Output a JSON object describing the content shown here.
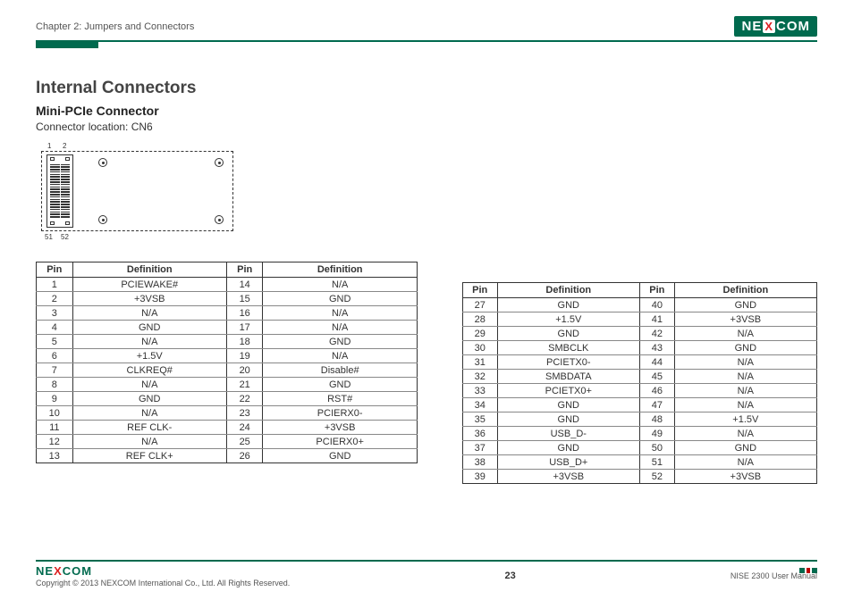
{
  "header": {
    "chapter": "Chapter 2: Jumpers and Connectors",
    "logo_text_pre": "NE",
    "logo_text_x": "X",
    "logo_text_post": "COM"
  },
  "titles": {
    "h1": "Internal Connectors",
    "h2": "Mini-PCIe Connector",
    "location": "Connector location: CN6"
  },
  "diagram_labels": {
    "p1": "1",
    "p2": "2",
    "p51": "51",
    "p52": "52"
  },
  "col_headers": {
    "pin": "Pin",
    "def": "Definition"
  },
  "table1": [
    {
      "pin": "1",
      "def": "PCIEWAKE#",
      "pin2": "14",
      "def2": "N/A"
    },
    {
      "pin": "2",
      "def": "+3VSB",
      "pin2": "15",
      "def2": "GND"
    },
    {
      "pin": "3",
      "def": "N/A",
      "pin2": "16",
      "def2": "N/A"
    },
    {
      "pin": "4",
      "def": "GND",
      "pin2": "17",
      "def2": "N/A"
    },
    {
      "pin": "5",
      "def": "N/A",
      "pin2": "18",
      "def2": "GND"
    },
    {
      "pin": "6",
      "def": "+1.5V",
      "pin2": "19",
      "def2": "N/A"
    },
    {
      "pin": "7",
      "def": "CLKREQ#",
      "pin2": "20",
      "def2": "Disable#"
    },
    {
      "pin": "8",
      "def": "N/A",
      "pin2": "21",
      "def2": "GND"
    },
    {
      "pin": "9",
      "def": "GND",
      "pin2": "22",
      "def2": "RST#"
    },
    {
      "pin": "10",
      "def": "N/A",
      "pin2": "23",
      "def2": "PCIERX0-"
    },
    {
      "pin": "11",
      "def": "REF CLK-",
      "pin2": "24",
      "def2": "+3VSB"
    },
    {
      "pin": "12",
      "def": "N/A",
      "pin2": "25",
      "def2": "PCIERX0+"
    },
    {
      "pin": "13",
      "def": "REF CLK+",
      "pin2": "26",
      "def2": "GND"
    }
  ],
  "table2": [
    {
      "pin": "27",
      "def": "GND",
      "pin2": "40",
      "def2": "GND"
    },
    {
      "pin": "28",
      "def": "+1.5V",
      "pin2": "41",
      "def2": "+3VSB"
    },
    {
      "pin": "29",
      "def": "GND",
      "pin2": "42",
      "def2": "N/A"
    },
    {
      "pin": "30",
      "def": "SMBCLK",
      "pin2": "43",
      "def2": "GND"
    },
    {
      "pin": "31",
      "def": "PCIETX0-",
      "pin2": "44",
      "def2": "N/A"
    },
    {
      "pin": "32",
      "def": "SMBDATA",
      "pin2": "45",
      "def2": "N/A"
    },
    {
      "pin": "33",
      "def": "PCIETX0+",
      "pin2": "46",
      "def2": "N/A"
    },
    {
      "pin": "34",
      "def": "GND",
      "pin2": "47",
      "def2": "N/A"
    },
    {
      "pin": "35",
      "def": "GND",
      "pin2": "48",
      "def2": "+1.5V"
    },
    {
      "pin": "36",
      "def": "USB_D-",
      "pin2": "49",
      "def2": "N/A"
    },
    {
      "pin": "37",
      "def": "GND",
      "pin2": "50",
      "def2": "GND"
    },
    {
      "pin": "38",
      "def": "USB_D+",
      "pin2": "51",
      "def2": "N/A"
    },
    {
      "pin": "39",
      "def": "+3VSB",
      "pin2": "52",
      "def2": "+3VSB"
    }
  ],
  "footer": {
    "copyright": "Copyright © 2013 NEXCOM International Co., Ltd. All Rights Reserved.",
    "page": "23",
    "doc": "NISE 2300 User Manual"
  }
}
